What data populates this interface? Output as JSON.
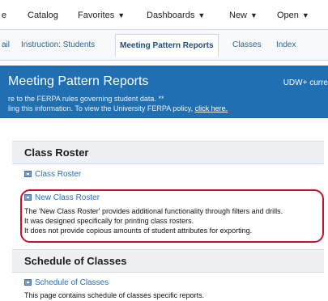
{
  "menu": {
    "items": [
      {
        "label": "e",
        "caret": false
      },
      {
        "label": "Catalog",
        "caret": false
      },
      {
        "label": "Favorites",
        "caret": true
      },
      {
        "label": "Dashboards",
        "caret": true
      },
      {
        "label": "New",
        "caret": true
      },
      {
        "label": "Open",
        "caret": true
      }
    ]
  },
  "tabs": [
    {
      "label": "ail"
    },
    {
      "label": "Instruction: Students"
    },
    {
      "label": "Meeting Pattern Reports"
    },
    {
      "label": "Classes"
    },
    {
      "label": "Index"
    }
  ],
  "banner": {
    "title": "Meeting Pattern Reports",
    "right": "UDW+ curre",
    "note1": "re to the FERPA rules governing student data. **",
    "note2_text": "ling this information. To view the University FERPA policy, ",
    "note2_link": "click here."
  },
  "sections": [
    {
      "heading": "Class Roster",
      "reports": [
        {
          "label": "Class Roster"
        },
        {
          "label": "New Class Roster",
          "desc": [
            "The 'New Class Roster' provides additional functionality through filters and drills.",
            "It was designed specifically for printing class rosters.",
            "It does not provide copious amounts of student attributes for exporting."
          ]
        }
      ]
    },
    {
      "heading": "Schedule of Classes",
      "reports": [
        {
          "label": "Schedule of Classes",
          "desc": [
            "This page contains schedule of classes specific reports."
          ]
        }
      ]
    }
  ],
  "colors": {
    "banner": "#1f6fb2",
    "link": "#2a6fb5",
    "highlight": "#c8102e"
  }
}
